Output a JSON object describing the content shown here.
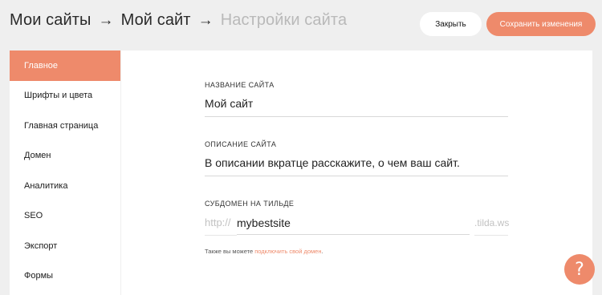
{
  "breadcrumb": {
    "items": [
      "Мои сайты",
      "Мой сайт",
      "Настройки сайта"
    ],
    "separator": "→"
  },
  "header": {
    "close_label": "Закрыть",
    "save_label": "Сохранить изменения"
  },
  "sidebar": {
    "items": [
      {
        "label": "Главное",
        "active": true
      },
      {
        "label": "Шрифты и цвета"
      },
      {
        "label": "Главная страница"
      },
      {
        "label": "Домен"
      },
      {
        "label": "Аналитика"
      },
      {
        "label": "SEO"
      },
      {
        "label": "Экспорт"
      },
      {
        "label": "Формы"
      }
    ]
  },
  "form": {
    "site_name": {
      "label": "Название сайта",
      "value": "Мой сайт"
    },
    "site_description": {
      "label": "Описание сайта",
      "value": "В описании вкратце расскажите, о чем ваш сайт."
    },
    "subdomain": {
      "label": "Субдомен на тильде",
      "prefix": "http://",
      "value": "mybestsite",
      "suffix": ".tilda.ws"
    },
    "hint_text": "Также вы можете ",
    "hint_link": "подключить свой домен",
    "hint_end": "."
  },
  "help": {
    "icon": "question-icon",
    "glyph": "?"
  },
  "colors": {
    "accent": "#ee8a6b",
    "background": "#efefef"
  }
}
